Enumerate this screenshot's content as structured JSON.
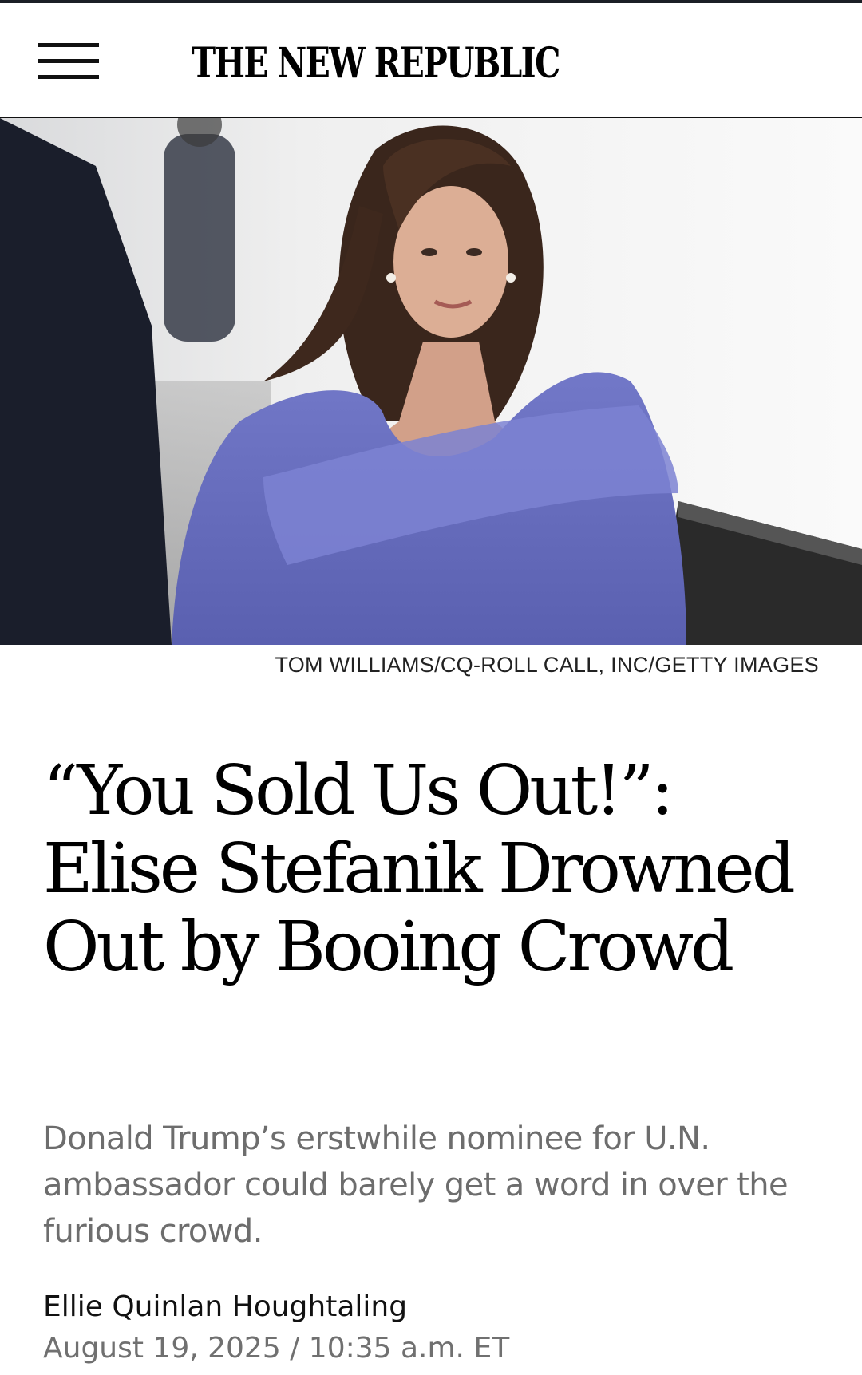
{
  "header": {
    "logo_text": "THE NEW REPUBLIC",
    "menu_icon": "hamburger-menu-icon"
  },
  "hero": {
    "photo_credit": "TOM WILLIAMS/CQ-ROLL CALL, INC/GETTY IMAGES"
  },
  "article": {
    "headline": "“You Sold Us Out!”: Elise Stefanik Drowned Out by Booing Crowd",
    "dek": "Donald Trump’s erstwhile nominee for U.N. ambassador could barely get a word in over the furious crowd.",
    "author": "Ellie Quinlan Houghtaling",
    "date": "August 19, 2025",
    "separator": "/",
    "time": "10:35 a.m. ET"
  },
  "colors": {
    "top_rule": "#1b1f26",
    "dek_gray": "#6d6d6d",
    "dress": "#6d73c4"
  }
}
